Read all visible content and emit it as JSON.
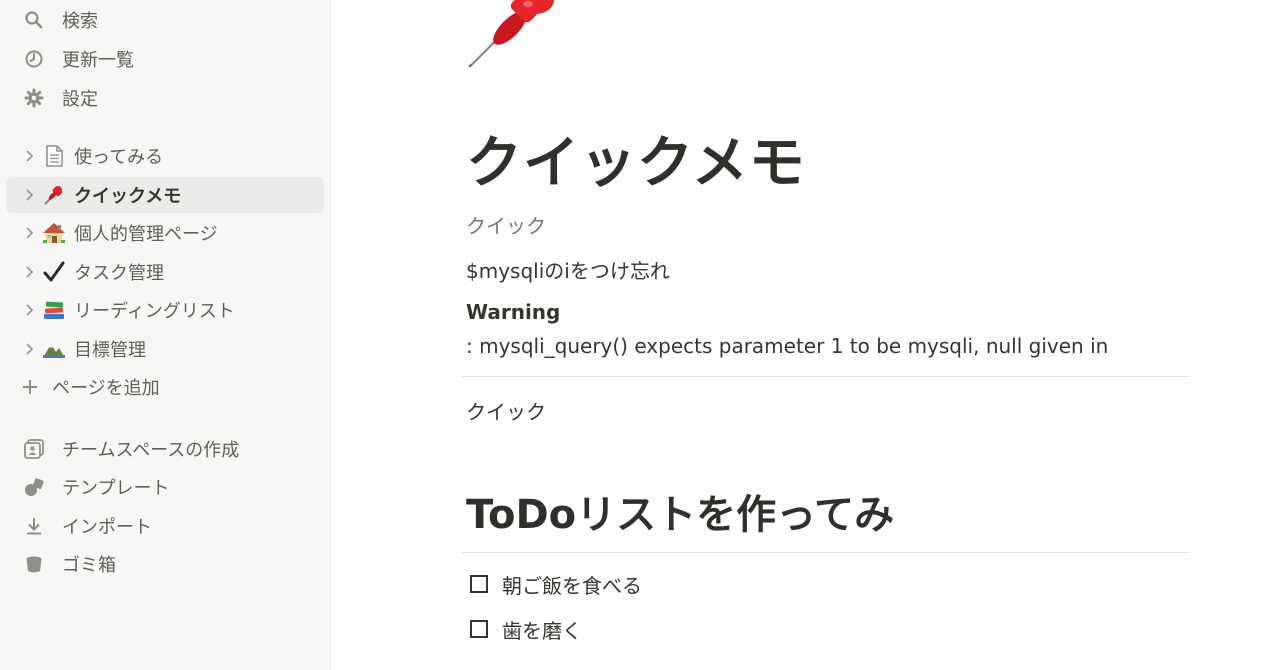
{
  "sidebar": {
    "top_items": [
      {
        "label": "検索",
        "icon": "search-icon"
      },
      {
        "label": "更新一覧",
        "icon": "clock-icon"
      },
      {
        "label": "設定",
        "icon": "gear-icon"
      }
    ],
    "pages": [
      {
        "label": "使ってみる",
        "icon": "page-icon"
      },
      {
        "label": "クイックメモ",
        "icon": "pushpin-emoji",
        "active": true
      },
      {
        "label": "個人的管理ページ",
        "icon": "house-emoji"
      },
      {
        "label": "タスク管理",
        "icon": "checkmark-emoji"
      },
      {
        "label": "リーディングリスト",
        "icon": "books-emoji"
      },
      {
        "label": "目標管理",
        "icon": "mountain-emoji"
      }
    ],
    "add_page": "ページを追加",
    "bottom_items": [
      {
        "label": "チームスペースの作成",
        "icon": "teamspace-icon"
      },
      {
        "label": "テンプレート",
        "icon": "shapes-icon"
      },
      {
        "label": "インポート",
        "icon": "download-icon"
      },
      {
        "label": "ゴミ箱",
        "icon": "trash-icon"
      }
    ]
  },
  "page": {
    "icon": "pushpin-emoji",
    "title": "クイックメモ",
    "blocks": {
      "quick1": "クイック",
      "line1": "$mysqliのiをつけ忘れ",
      "warning_label": "Warning",
      "warning_text": ": mysqli_query() expects parameter 1 to be mysqli, null given in",
      "quick2": "クイック"
    },
    "heading": "ToDoリストを作ってみ",
    "todos": [
      {
        "label": "朝ご飯を食べる",
        "checked": false
      },
      {
        "label": "歯を磨く",
        "checked": false
      }
    ]
  }
}
